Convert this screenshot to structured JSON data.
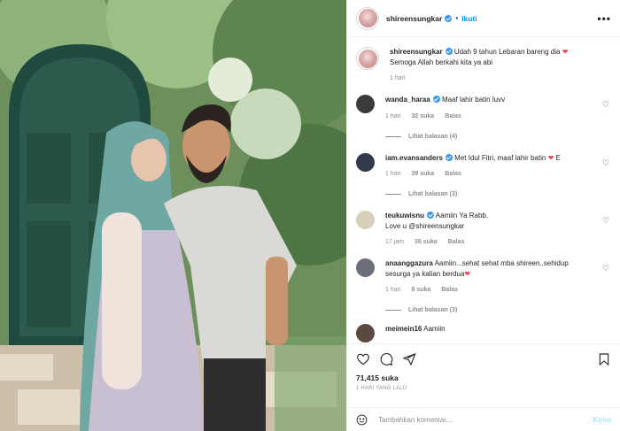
{
  "post": {
    "username": "shireensungkar",
    "follow_label": "Ikuti",
    "more_label": "•••",
    "separator": "•"
  },
  "caption": {
    "username": "shireensungkar",
    "line1": "Udah 9 tahun Lebaran bareng dia",
    "line2": "Semoga Allah berkahi kita ya abi",
    "time": "1 hari"
  },
  "comments": [
    {
      "username": "wanda_haraa",
      "text": "Maaf lahir batin luvv",
      "time": "1 hari",
      "likes": "32 suka",
      "reply": "Balas",
      "view_replies": "Lihat balasan (4)",
      "avatar_color": "#3b3b3b"
    },
    {
      "username": "iam.evansanders",
      "text": "Met Idul Fitri, maaf lahir batin",
      "suffix": "E",
      "time": "1 hari",
      "likes": "39 suka",
      "reply": "Balas",
      "view_replies": "Lihat balasan (3)",
      "avatar_color": "#2f3a4a"
    },
    {
      "username": "teukuwisnu",
      "text": "Aamiin Ya Rabb.",
      "text2": "Love u @shireensungkar",
      "time": "17 jam",
      "likes": "36 suka",
      "reply": "Balas",
      "view_replies": "",
      "avatar_color": "#d8cfb8"
    },
    {
      "username": "anaanggazura",
      "text": "Aamiin...sehat sehat mba shireen..sehidup",
      "text2": "sesurga ya kalian berdua",
      "time": "1 hari",
      "likes": "8 suka",
      "reply": "Balas",
      "view_replies": "Lihat balasan (3)",
      "avatar_color": "#6a6f78"
    },
    {
      "username": "meimein16",
      "text": "Aamiin",
      "avatar_color": "#5a4a40"
    }
  ],
  "actions": {
    "likes": "71,415 suka",
    "date": "1 HARI YANG LALU",
    "comment_placeholder": "Tambahkan komentar...",
    "send_label": "Kirim"
  },
  "icons": {
    "heart": "heart-icon",
    "comment": "comment-icon",
    "share": "share-icon",
    "bookmark": "bookmark-icon",
    "emoji": "emoji-icon"
  },
  "colors": {
    "link": "#0095f6",
    "verified": "#3897f0",
    "heart_red": "#ed4956",
    "muted": "#8e8e8e"
  }
}
